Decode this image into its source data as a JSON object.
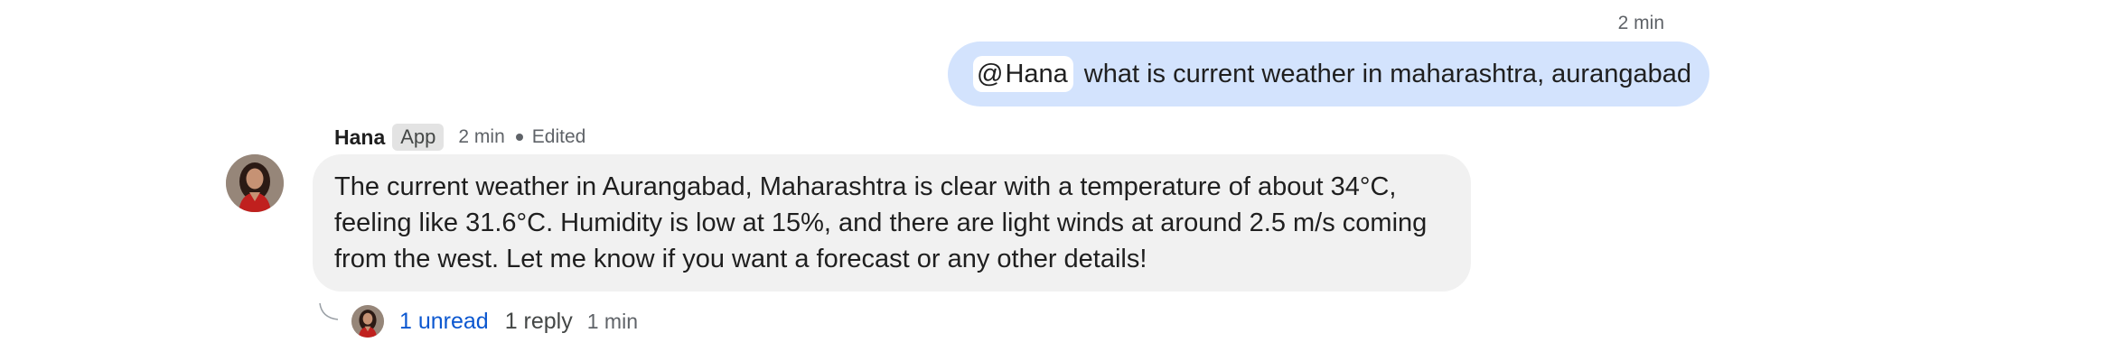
{
  "outgoing": {
    "time": "2 min",
    "mention": {
      "symbol": "@",
      "name": "Hana"
    },
    "text": "what is current weather in maharashtra, aurangabad"
  },
  "incoming": {
    "sender": "Hana",
    "badge": "App",
    "time": "2 min",
    "edited": "Edited",
    "avatar_icon": "profile-photo",
    "lines": [
      "The current weather in Aurangabad, Maharashtra is clear with a temperature of about 34°C,",
      "feeling like 31.6°C. Humidity is low at 15%, and there are light winds at around 2.5 m/s coming",
      "from the west. Let me know if you want a forecast or any other details!"
    ]
  },
  "thread": {
    "unread": "1 unread",
    "replies": "1 reply",
    "time": "1 min"
  },
  "colors": {
    "outgoing_bubble": "#d3e3fd",
    "incoming_bubble": "#f1f1f1",
    "link": "#0b57d0",
    "muted": "#5f6368"
  }
}
